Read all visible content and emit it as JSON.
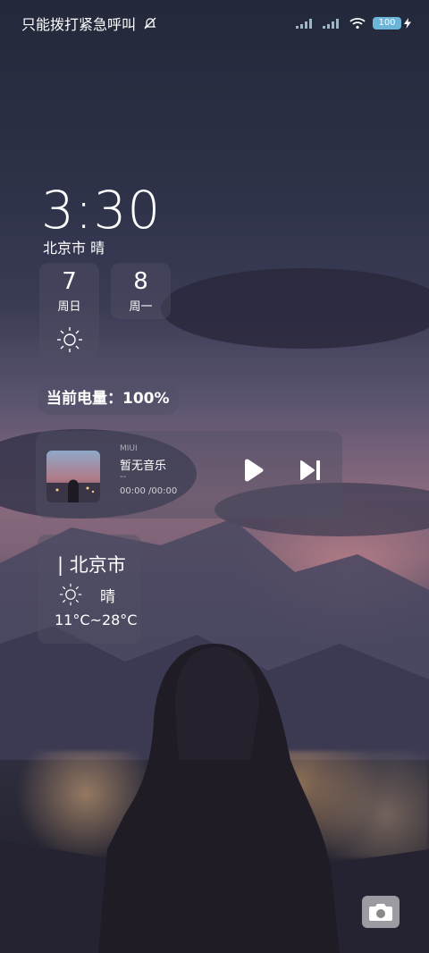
{
  "status_bar": {
    "carrier_text": "只能拨打紧急呼叫",
    "battery_level": "100",
    "icons": [
      "bell-off-icon",
      "signal-icon",
      "signal-icon",
      "wifi-icon",
      "battery-icon",
      "charging-icon"
    ]
  },
  "clock": {
    "time": "3:30",
    "city": "北京市",
    "condition": "晴"
  },
  "dates": [
    {
      "day": "7",
      "weekday": "周日",
      "icon": "sun-icon"
    },
    {
      "day": "8",
      "weekday": "周一"
    }
  ],
  "battery_widget": {
    "text": "当前电量：100%"
  },
  "music": {
    "brand": "MIUI",
    "title": "暂无音乐",
    "artist": "--",
    "time": "00:00 /00:00",
    "icons": [
      "play-icon",
      "next-icon"
    ]
  },
  "weather": {
    "city": "| 北京市",
    "condition": "晴",
    "range": "11°C~28°C",
    "icon": "sun-icon"
  },
  "camera": {
    "icon": "camera-icon"
  }
}
